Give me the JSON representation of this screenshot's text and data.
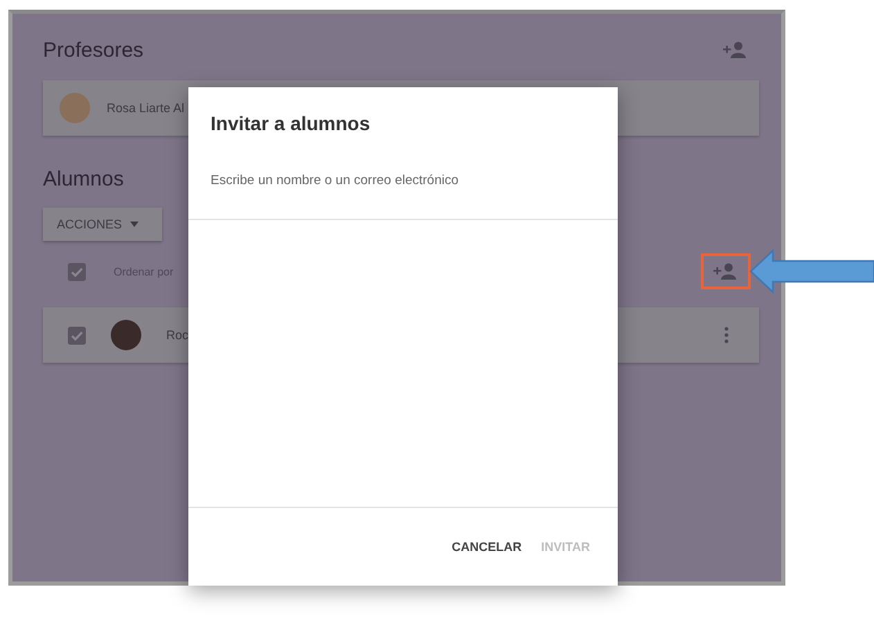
{
  "profesores": {
    "title": "Profesores",
    "teachers": [
      {
        "name": "Rosa Liarte Al"
      }
    ]
  },
  "alumnos": {
    "title": "Alumnos",
    "actions_button": "ACCIONES",
    "select_all_checked": true,
    "sort_label": "Ordenar por",
    "add_highlighted": true,
    "students": [
      {
        "name": "Roc",
        "checked": true
      }
    ]
  },
  "dialog": {
    "title": "Invitar a alumnos",
    "placeholder": "Escribe un nombre o un correo electrónico",
    "buttons": [
      {
        "label": "CANCELAR",
        "disabled": false
      },
      {
        "label": "INVITAR",
        "disabled": true
      }
    ]
  }
}
